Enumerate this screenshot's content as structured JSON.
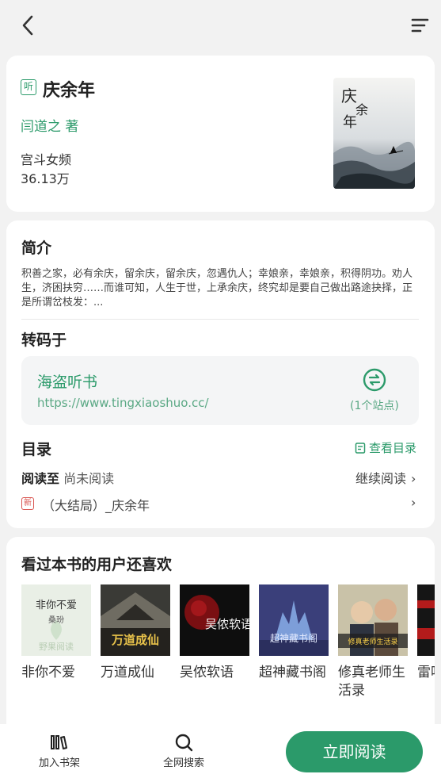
{
  "book": {
    "listen_badge": "听",
    "title": "庆余年",
    "author": "闫道之 著",
    "genre": "宫斗女频",
    "count": "36.13万",
    "cover_title": "庆余年"
  },
  "intro": {
    "heading": "简介",
    "text": "积善之家，必有余庆，留余庆，留余庆，忽遇仇人；幸娘亲，幸娘亲，积得阴功。劝人生，济困扶穷……而谁可知，人生于世，上承余庆，终究却是要自己做出路途抉择，正是所谓岔枝发：..."
  },
  "source": {
    "heading": "转码于",
    "name": "海盗听书",
    "url": "https://www.tingxiaoshuo.cc/",
    "count": "(1个站点)"
  },
  "toc": {
    "heading": "目录",
    "view_label": "查看目录",
    "read_at_label": "阅读至",
    "read_at_value": "尚未阅读",
    "continue_label": "继续阅读",
    "new_badge": "新",
    "latest_chapter": "（大结局）_庆余年"
  },
  "recommend": {
    "heading": "看过本书的用户还喜欢",
    "items": [
      {
        "name": "非你不爱",
        "cover_text": "非你不爱",
        "cover_sub": "桑玢",
        "cover_brand": "野果阅读"
      },
      {
        "name": "万道成仙",
        "cover_text": "万道成仙"
      },
      {
        "name": "吴侬软语",
        "cover_text": "吴侬软语"
      },
      {
        "name": "超神藏书阁",
        "cover_text": "超神藏书阁"
      },
      {
        "name": "修真老师生活录",
        "cover_text": "修真老师生活录"
      },
      {
        "name": "雷鸣东方",
        "cover_text": ""
      }
    ]
  },
  "bottom": {
    "shelf_label": "加入书架",
    "search_label": "全网搜索",
    "read_now_label": "立即阅读"
  },
  "colors": {
    "accent": "#2b9a6a",
    "badge_red": "#d9534f",
    "background": "#f2f2f2"
  }
}
